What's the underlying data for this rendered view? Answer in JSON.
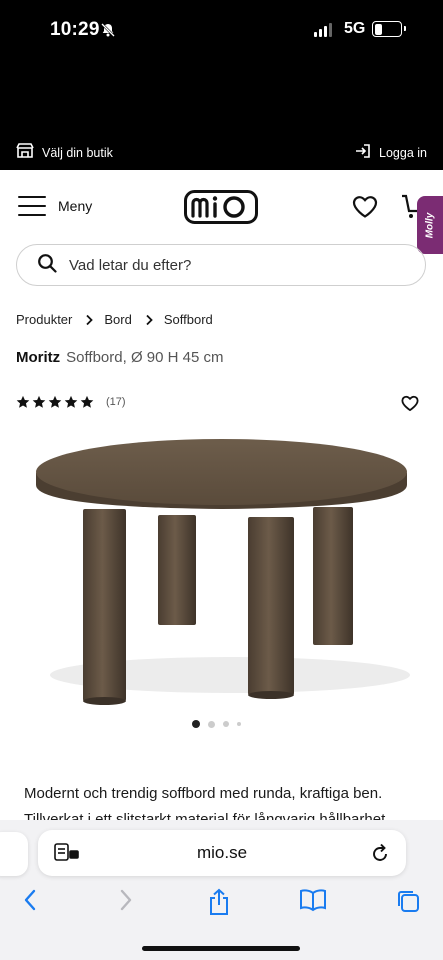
{
  "status_bar": {
    "time": "10:29",
    "network": "5G"
  },
  "store_bar": {
    "store_label": "Välj din butik",
    "login_label": "Logga in"
  },
  "header": {
    "menu_label": "Meny",
    "logo_text": "mio",
    "molly_label": "Molly"
  },
  "search": {
    "placeholder": "Vad letar du efter?"
  },
  "breadcrumb": [
    "Produkter",
    "Bord",
    "Soffbord"
  ],
  "product": {
    "brand": "Moritz",
    "subtitle": "Soffbord, Ø 90 H 45 cm",
    "rating_stars": 5,
    "review_count": "(17)",
    "image_count": 4,
    "active_image": 1,
    "description_lines": [
      "Modernt och trendig soffbord med runda, kraftiga ben.",
      "Tillverkat i ett slitstarkt material för långvarig hållbarhet."
    ]
  },
  "browser": {
    "url": "mio.se"
  },
  "icons": [
    "bell-slash-icon",
    "signal-icon",
    "battery-icon",
    "store-icon",
    "login-icon",
    "menu-icon",
    "heart-icon",
    "cart-icon",
    "search-icon",
    "chevron-right-icon",
    "star-icon",
    "tabs-icon",
    "reload-icon",
    "back-icon",
    "forward-icon",
    "share-icon",
    "bookmarks-icon",
    "tabs-overview-icon"
  ],
  "colors": {
    "brand_purple": "#7b2c73",
    "ios_blue": "#1a7cf0",
    "table_wood": "#5e4e3e"
  }
}
